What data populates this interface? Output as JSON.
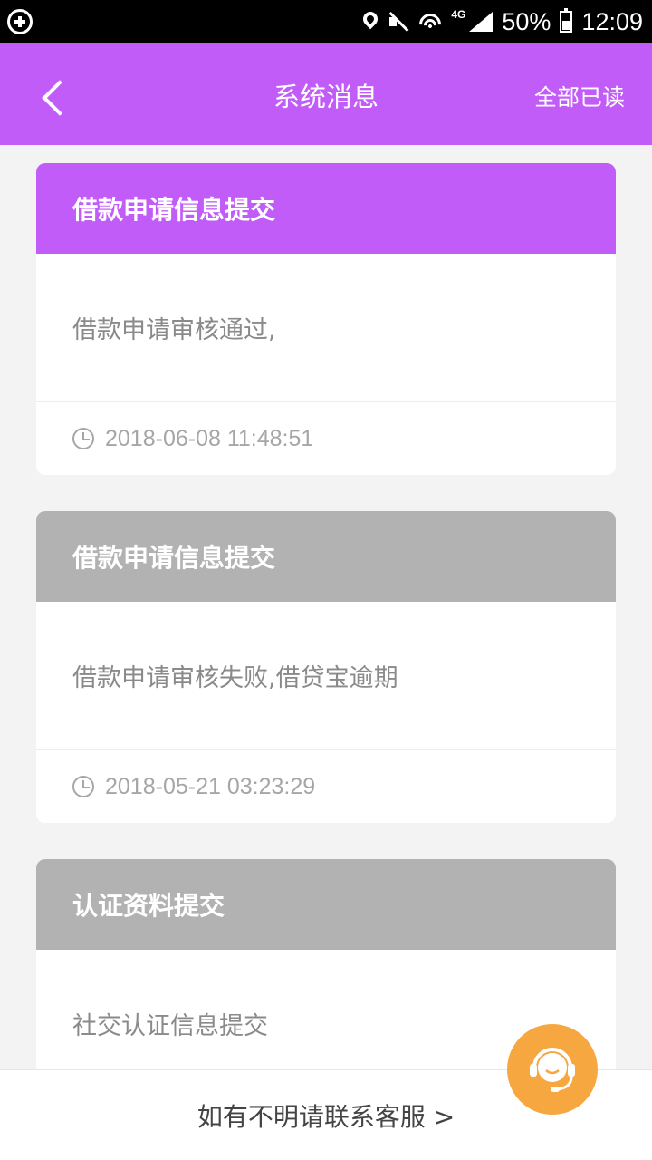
{
  "status_bar": {
    "battery": "50%",
    "time": "12:09",
    "network": "4G"
  },
  "header": {
    "title": "系统消息",
    "read_all": "全部已读",
    "color": "#c25cf8"
  },
  "messages": [
    {
      "title": "借款申请信息提交",
      "body": "借款申请审核通过,",
      "time": "2018-06-08 11:48:51",
      "state": "unread",
      "head_color": "#c25cf8"
    },
    {
      "title": "借款申请信息提交",
      "body": "借款申请审核失败,借贷宝逾期",
      "time": "2018-05-21 03:23:29",
      "state": "read",
      "head_color": "#b2b2b2"
    },
    {
      "title": "认证资料提交",
      "body": "社交认证信息提交",
      "time": "",
      "state": "read",
      "head_color": "#b2b2b2"
    }
  ],
  "footer": {
    "link": "如有不明请联系客服 >"
  },
  "support": {
    "icon": "customer-service-icon",
    "color": "#f7a740"
  }
}
